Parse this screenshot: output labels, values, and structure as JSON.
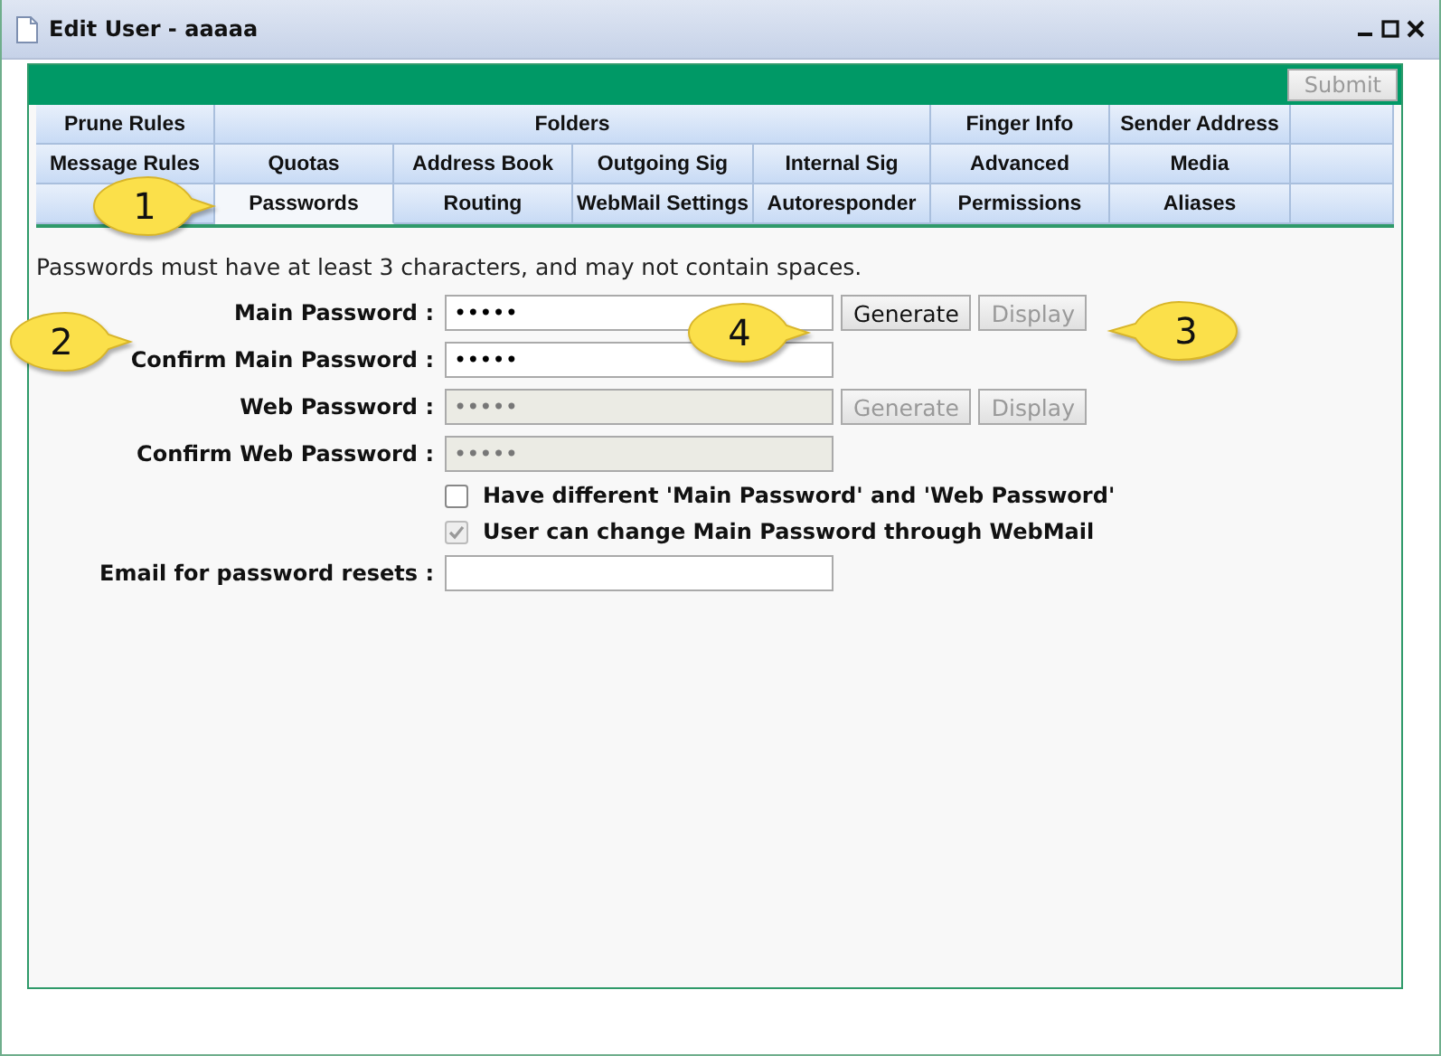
{
  "window": {
    "title": "Edit User - aaaaa"
  },
  "submit": {
    "label": "Submit",
    "disabled": true
  },
  "tab_rows": [
    [
      {
        "label": "Prune Rules",
        "selected": false
      },
      {
        "label": "Folders",
        "selected": false
      },
      {
        "label": "Finger Info",
        "selected": false
      },
      {
        "label": "Sender Address",
        "selected": false
      }
    ],
    [
      {
        "label": "Message Rules",
        "selected": false
      },
      {
        "label": "Quotas",
        "selected": false
      },
      {
        "label": "Address Book",
        "selected": false
      },
      {
        "label": "Outgoing Sig",
        "selected": false
      },
      {
        "label": "Internal Sig",
        "selected": false
      },
      {
        "label": "Advanced",
        "selected": false
      },
      {
        "label": "Media",
        "selected": false
      }
    ],
    [
      {
        "label": "Passwords",
        "selected": true
      },
      {
        "label": "Routing",
        "selected": false
      },
      {
        "label": "WebMail Settings",
        "selected": false
      },
      {
        "label": "Autoresponder",
        "selected": false
      },
      {
        "label": "Permissions",
        "selected": false
      },
      {
        "label": "Aliases",
        "selected": false
      }
    ]
  ],
  "note": "Passwords must have at least 3 characters, and may not contain spaces.",
  "fields": [
    {
      "kind": "field",
      "label": "Main Password :",
      "value": "•••••",
      "disabled": false,
      "buttons": [
        {
          "label": "Generate",
          "disabled": false
        },
        {
          "label": "Display",
          "disabled": true
        }
      ]
    },
    {
      "kind": "field",
      "label": "Confirm Main Password :",
      "value": "•••••",
      "disabled": false
    },
    {
      "kind": "field",
      "label": "Web Password :",
      "value": "•••••",
      "disabled": true,
      "buttons": [
        {
          "label": "Generate",
          "disabled": true
        },
        {
          "label": "Display",
          "disabled": true
        }
      ]
    },
    {
      "kind": "field",
      "label": "Confirm Web Password :",
      "value": "•••••",
      "disabled": true
    },
    {
      "kind": "checkbox",
      "label": "Have different 'Main Password' and 'Web Password'",
      "checked": false,
      "disabled": false
    },
    {
      "kind": "checkbox",
      "label": "User can change Main Password through WebMail",
      "checked": true,
      "disabled": true
    },
    {
      "kind": "field",
      "label": "Email for password resets :",
      "disabled": false
    }
  ],
  "callouts": [
    {
      "number": "1"
    },
    {
      "number": "2"
    },
    {
      "number": "4"
    },
    {
      "number": "3"
    }
  ]
}
